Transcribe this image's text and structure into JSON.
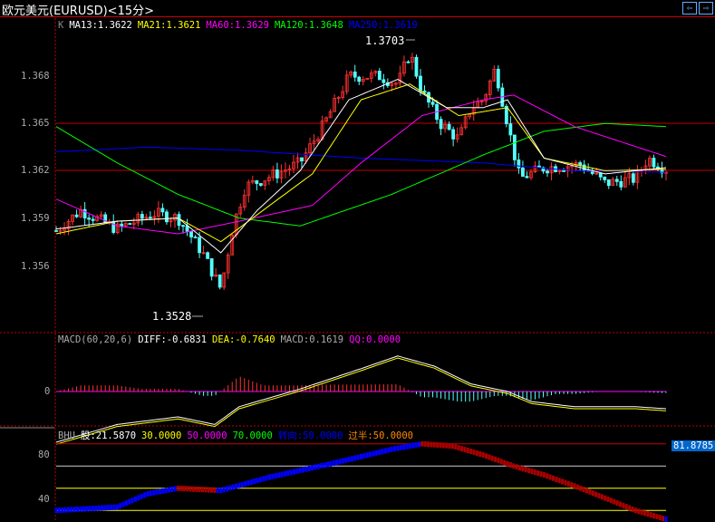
{
  "window": {
    "title": "欧元美元(EURUSD)<15分>",
    "prev_label": "⇦",
    "next_label": "⇨"
  },
  "price_panel": {
    "legend": {
      "k": "K",
      "ma13": "MA13:1.3622",
      "ma21": "MA21:1.3621",
      "ma60": "MA60:1.3629",
      "ma120": "MA120:1.3648",
      "ma250": "MA250:1.3619"
    },
    "y_ticks": [
      "1.368",
      "1.365",
      "1.362",
      "1.359",
      "1.356"
    ],
    "high_label": "1.3703",
    "low_label": "1.3528"
  },
  "macd_panel": {
    "legend": {
      "name": "MACD(60,20,6)",
      "diff": "DIFF:-0.6831",
      "dea": "DEA:-0.7640",
      "macd": "MACD:0.1619",
      "qq": "QQ:0.0000"
    },
    "y_ticks": [
      "0"
    ]
  },
  "bhu_panel": {
    "legend": {
      "name": "BHU",
      "gu": "股:21.5870",
      "v30": "30.0000",
      "v50": "50.0000",
      "v70": "70.0000",
      "turn": "转向:50.0000",
      "half": "过半:50.0000"
    },
    "y_ticks": [
      "80",
      "40"
    ],
    "current_value": "81.8785"
  },
  "colors": {
    "up": "#ff3232",
    "down": "#54ffff",
    "ma13": "#ffffff",
    "ma21": "#ffff00",
    "ma60": "#ff00ff",
    "ma120": "#00ff00",
    "ma250": "#0000ff",
    "grid": "#c00000"
  },
  "chart_data": {
    "type": "candlestick",
    "price_range": [
      1.3535,
      1.3712
    ],
    "close_path": [
      [
        0,
        1.3582
      ],
      [
        0.04,
        1.3595
      ],
      [
        0.1,
        1.3583
      ],
      [
        0.16,
        1.3593
      ],
      [
        0.2,
        1.359
      ],
      [
        0.24,
        1.3568
      ],
      [
        0.27,
        1.3545
      ],
      [
        0.29,
        1.3585
      ],
      [
        0.31,
        1.361
      ],
      [
        0.36,
        1.3618
      ],
      [
        0.4,
        1.3625
      ],
      [
        0.44,
        1.365
      ],
      [
        0.48,
        1.368
      ],
      [
        0.53,
        1.368
      ],
      [
        0.56,
        1.3675
      ],
      [
        0.58,
        1.3695
      ],
      [
        0.6,
        1.367
      ],
      [
        0.63,
        1.365
      ],
      [
        0.66,
        1.364
      ],
      [
        0.68,
        1.366
      ],
      [
        0.7,
        1.3665
      ],
      [
        0.72,
        1.3685
      ],
      [
        0.74,
        1.365
      ],
      [
        0.76,
        1.3615
      ],
      [
        0.8,
        1.3622
      ],
      [
        0.86,
        1.3624
      ],
      [
        0.9,
        1.3612
      ],
      [
        0.95,
        1.3615
      ],
      [
        0.97,
        1.3628
      ],
      [
        1,
        1.3621
      ]
    ],
    "ma13": [
      [
        0,
        1.3583
      ],
      [
        0.1,
        1.3588
      ],
      [
        0.2,
        1.359
      ],
      [
        0.27,
        1.3568
      ],
      [
        0.33,
        1.3595
      ],
      [
        0.4,
        1.362
      ],
      [
        0.48,
        1.3665
      ],
      [
        0.56,
        1.3678
      ],
      [
        0.64,
        1.366
      ],
      [
        0.7,
        1.366
      ],
      [
        0.74,
        1.3665
      ],
      [
        0.8,
        1.3628
      ],
      [
        0.9,
        1.3618
      ],
      [
        1,
        1.3622
      ]
    ],
    "ma21": [
      [
        0,
        1.358
      ],
      [
        0.1,
        1.3588
      ],
      [
        0.2,
        1.359
      ],
      [
        0.27,
        1.3575
      ],
      [
        0.35,
        1.3598
      ],
      [
        0.42,
        1.3618
      ],
      [
        0.5,
        1.3665
      ],
      [
        0.58,
        1.3675
      ],
      [
        0.66,
        1.3655
      ],
      [
        0.74,
        1.366
      ],
      [
        0.8,
        1.3628
      ],
      [
        0.9,
        1.362
      ],
      [
        1,
        1.3621
      ]
    ],
    "ma60": [
      [
        0,
        1.3602
      ],
      [
        0.1,
        1.3585
      ],
      [
        0.2,
        1.358
      ],
      [
        0.3,
        1.3588
      ],
      [
        0.42,
        1.3598
      ],
      [
        0.5,
        1.3625
      ],
      [
        0.6,
        1.3655
      ],
      [
        0.7,
        1.3665
      ],
      [
        0.75,
        1.3668
      ],
      [
        0.85,
        1.3648
      ],
      [
        1,
        1.3629
      ]
    ],
    "ma120": [
      [
        0,
        1.3648
      ],
      [
        0.1,
        1.3625
      ],
      [
        0.2,
        1.3605
      ],
      [
        0.3,
        1.359
      ],
      [
        0.4,
        1.3585
      ],
      [
        0.55,
        1.3605
      ],
      [
        0.7,
        1.363
      ],
      [
        0.8,
        1.3645
      ],
      [
        0.9,
        1.365
      ],
      [
        1,
        1.3648
      ]
    ],
    "ma250": [
      [
        0,
        1.3632
      ],
      [
        0.15,
        1.3635
      ],
      [
        0.3,
        1.3633
      ],
      [
        0.5,
        1.3628
      ],
      [
        0.7,
        1.3625
      ],
      [
        0.85,
        1.362
      ],
      [
        1,
        1.3619
      ]
    ],
    "macd_diff": [
      [
        0,
        -2.0
      ],
      [
        0.1,
        -1.3
      ],
      [
        0.2,
        -1.0
      ],
      [
        0.26,
        -1.3
      ],
      [
        0.3,
        -0.6
      ],
      [
        0.4,
        0.1
      ],
      [
        0.5,
        0.9
      ],
      [
        0.56,
        1.4
      ],
      [
        0.62,
        1.0
      ],
      [
        0.68,
        0.3
      ],
      [
        0.74,
        0.0
      ],
      [
        0.78,
        -0.4
      ],
      [
        0.85,
        -0.6
      ],
      [
        0.95,
        -0.6
      ],
      [
        1,
        -0.68
      ]
    ],
    "bhu": [
      [
        0,
        30
      ],
      [
        0.1,
        33
      ],
      [
        0.15,
        45
      ],
      [
        0.2,
        50
      ],
      [
        0.27,
        48
      ],
      [
        0.35,
        60
      ],
      [
        0.45,
        72
      ],
      [
        0.55,
        85
      ],
      [
        0.6,
        90
      ],
      [
        0.65,
        88
      ],
      [
        0.7,
        80
      ],
      [
        0.75,
        70
      ],
      [
        0.8,
        62
      ],
      [
        0.86,
        50
      ],
      [
        0.95,
        30
      ],
      [
        1,
        22
      ]
    ]
  }
}
